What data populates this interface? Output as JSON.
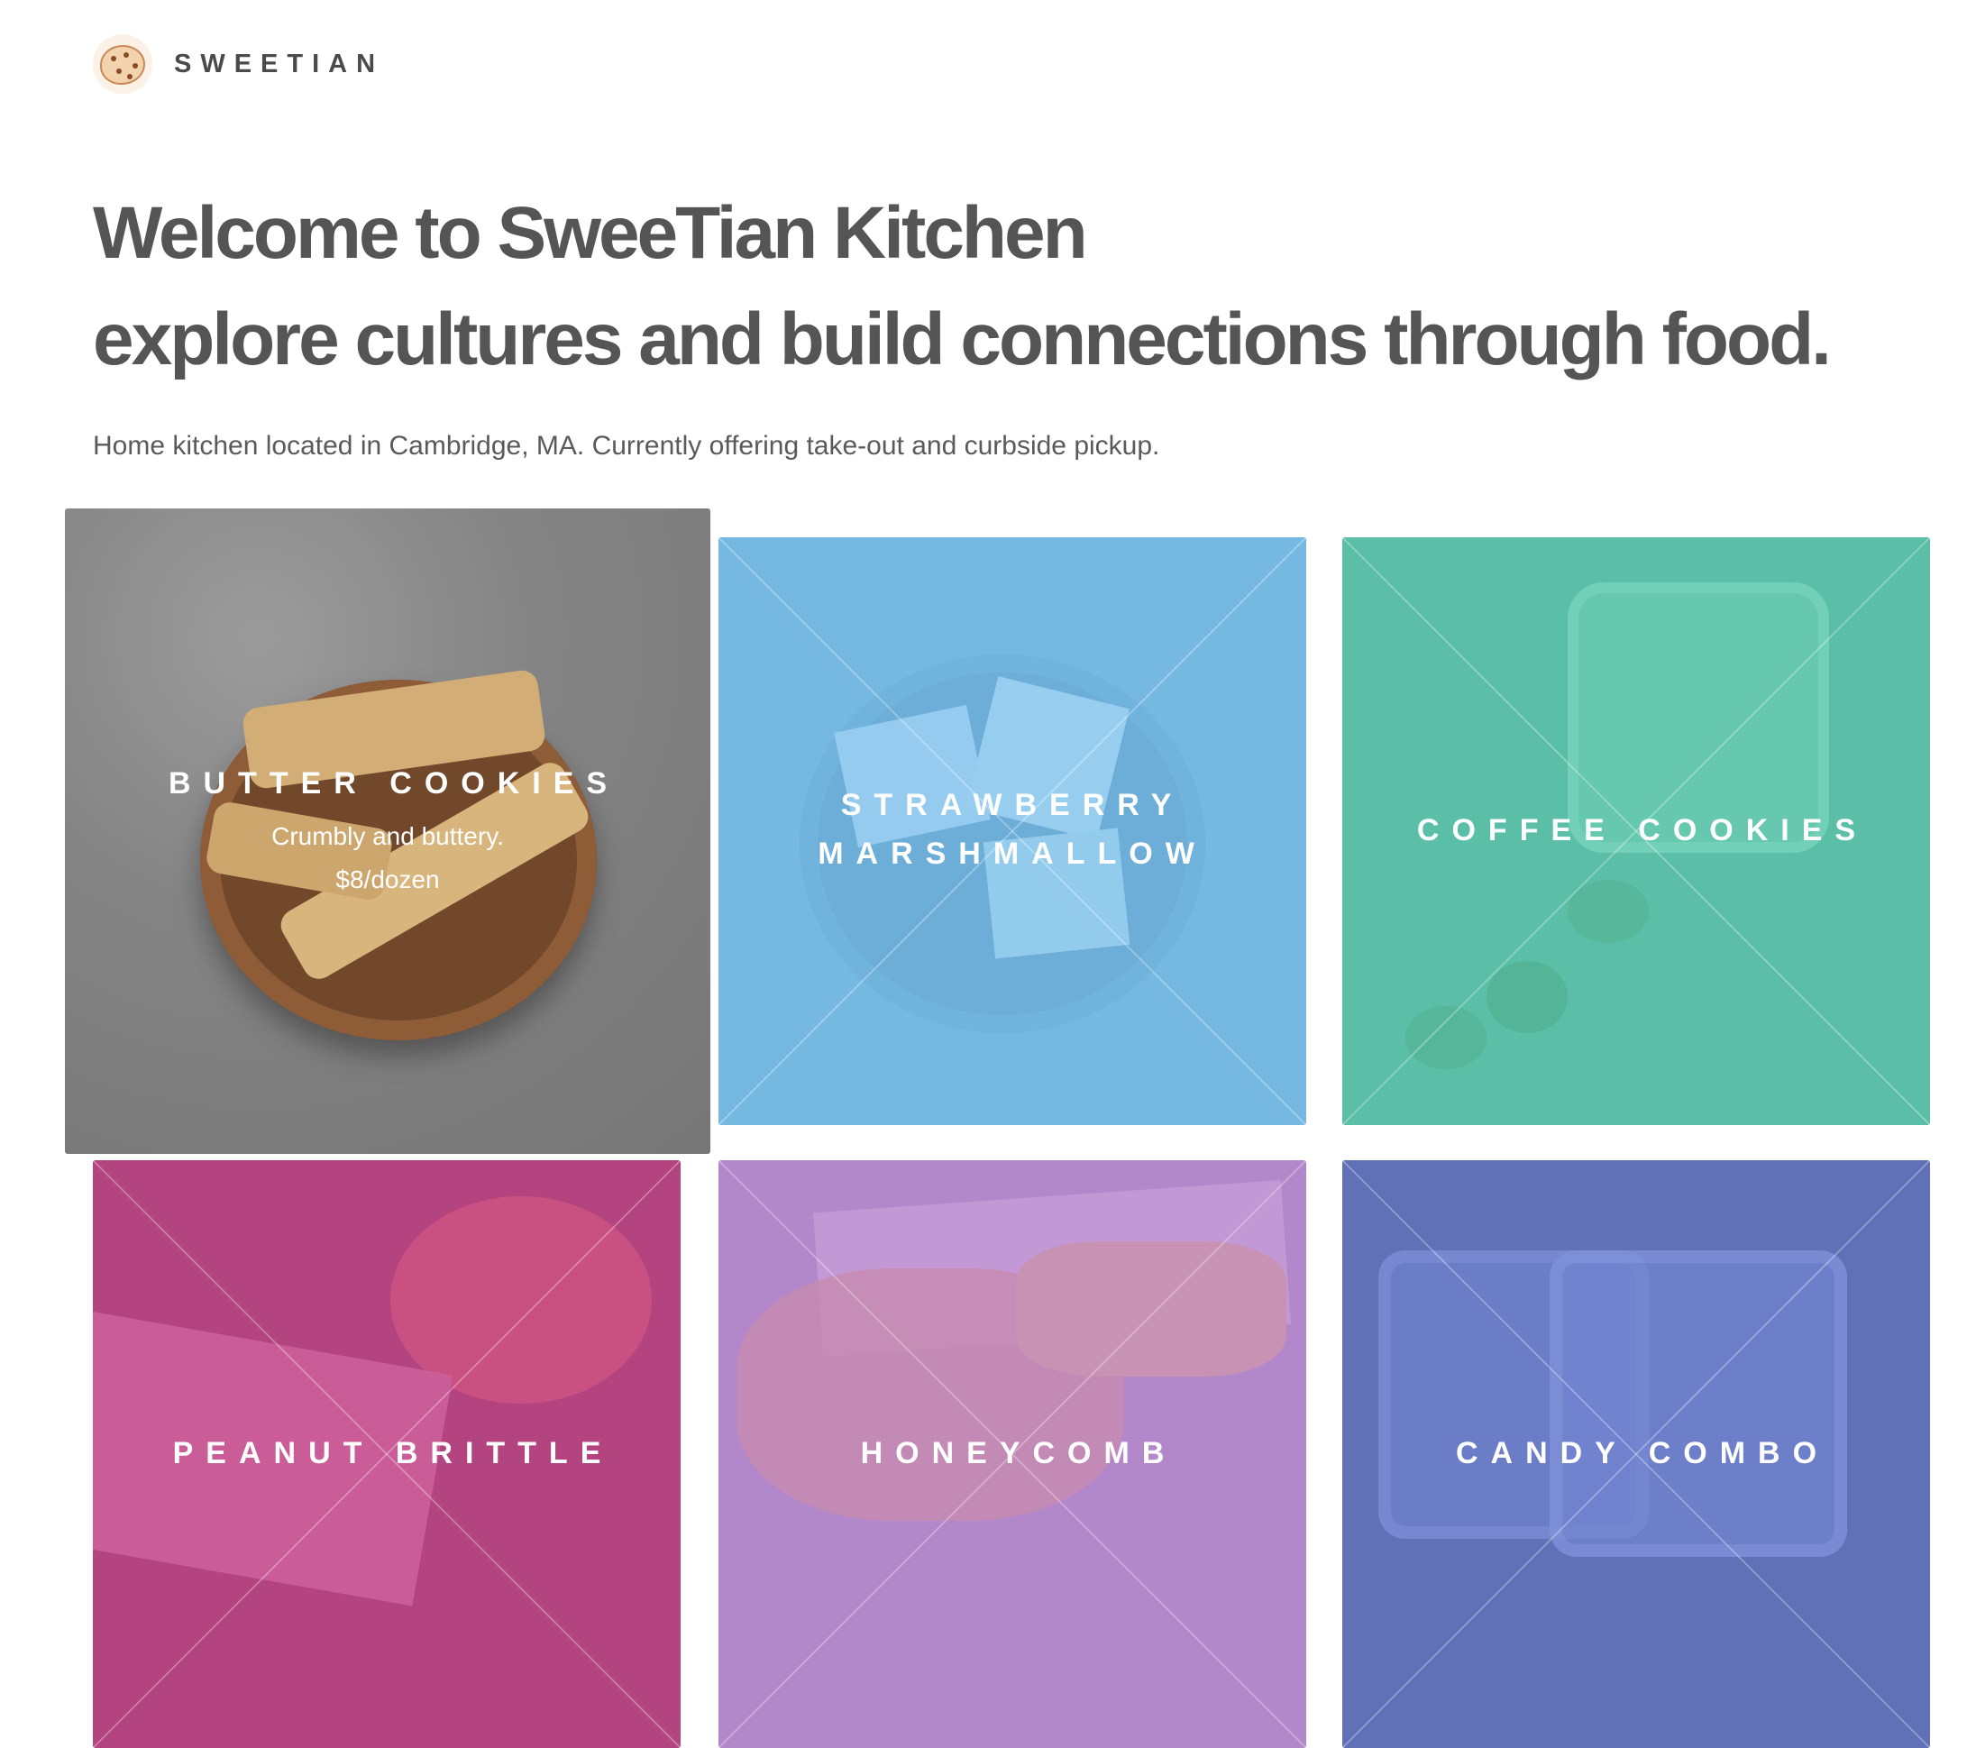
{
  "brand": {
    "name": "SWEETIAN"
  },
  "hero": {
    "line1": "Welcome to SweeTian Kitchen",
    "line2": "explore cultures and build connections through food."
  },
  "tagline": "Home kitchen located in Cambridge, MA. Currently offering take-out and curbside pickup.",
  "products": [
    {
      "title": "BUTTER COOKIES",
      "description": "Crumbly and buttery.",
      "price": "$8/dozen",
      "tint": "#9c9c9c",
      "state": "hovered"
    },
    {
      "title": "STRAWBERRY MARSHMALLOW",
      "tint": "#78c1ec"
    },
    {
      "title": "COFFEE COOKIES",
      "tint": "#5fcdb2"
    },
    {
      "title": "PEANUT BRITTLE",
      "tint": "#c4478c"
    },
    {
      "title": "HONEYCOMB",
      "tint": "#b78ad0"
    },
    {
      "title": "CANDY COMBO",
      "tint": "#6e7fd2"
    }
  ]
}
